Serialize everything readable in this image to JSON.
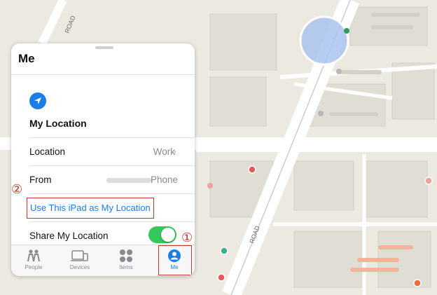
{
  "panel": {
    "title": "Me",
    "section_title": "My Location",
    "rows": [
      {
        "label": "Location",
        "value": "Work"
      },
      {
        "label": "From",
        "value": "Phone"
      }
    ],
    "link_label": "Use This iPad as My Location",
    "share_label": "Share My Location",
    "share_enabled": true
  },
  "tabs": [
    {
      "label": "People",
      "icon": "people-icon"
    },
    {
      "label": "Devices",
      "icon": "devices-icon"
    },
    {
      "label": "Items",
      "icon": "items-icon"
    },
    {
      "label": "Me",
      "icon": "me-icon",
      "active": true
    }
  ],
  "annotations": {
    "step1": "①",
    "step2": "②"
  },
  "map": {
    "street_label": "ROAD",
    "street_label_top": "ROAD"
  },
  "colors": {
    "accent": "#1a7ee6",
    "toggle_on": "#34c759",
    "annotation": "#c0392b"
  }
}
